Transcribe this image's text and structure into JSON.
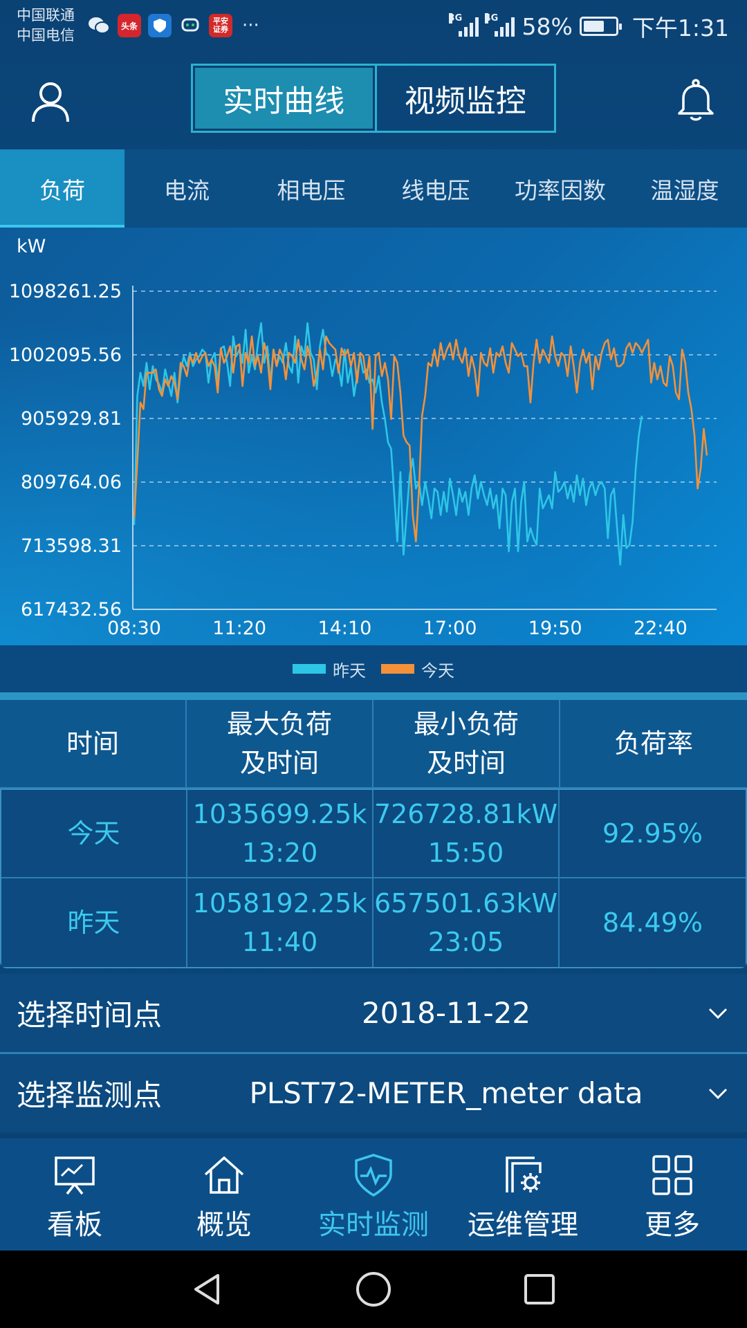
{
  "status_bar": {
    "carrier_1": "中国联通",
    "carrier_2": "中国电信",
    "notification_icons": [
      "wechat-icon",
      "toutiao-icon",
      "shield-app-icon",
      "cloud-chat-icon",
      "pingan-icon"
    ],
    "toutiao_label": "头条",
    "pingan_label": "平安\n证券",
    "more": "···",
    "signal_1_label": "3G",
    "signal_2_label": "4G",
    "battery_level": "58%",
    "battery_fraction": 0.58,
    "time": "下午1:31"
  },
  "header": {
    "user_icon": "user-icon",
    "bell_icon": "bell-icon",
    "segments": [
      {
        "label": "实时曲线",
        "active": true
      },
      {
        "label": "视频监控",
        "active": false
      }
    ]
  },
  "tabs": [
    {
      "label": "负荷",
      "active": true
    },
    {
      "label": "电流",
      "active": false
    },
    {
      "label": "相电压",
      "active": false
    },
    {
      "label": "线电压",
      "active": false
    },
    {
      "label": "功率因数",
      "active": false
    },
    {
      "label": "温湿度",
      "active": false
    }
  ],
  "chart_data": {
    "type": "line",
    "unit": "kW",
    "yticks": [
      "1098261.25",
      "1002095.56",
      "905929.81",
      "809764.06",
      "713598.31",
      "617432.56"
    ],
    "ylim": [
      617432.56,
      1098261.25
    ],
    "xticks": [
      "08:30",
      "11:20",
      "14:10",
      "17:00",
      "19:50",
      "22:40"
    ],
    "x_start_minutes": 510,
    "x_step_minutes": 5,
    "grid": "dashed-horizontal",
    "legend_placement": "bottom-center",
    "series": [
      {
        "name": "昨天",
        "color": "#2ec6e6",
        "values": [
          745000,
          940000,
          975000,
          955000,
          990000,
          950000,
          985000,
          965000,
          958000,
          945000,
          980000,
          960000,
          940000,
          975000,
          930000,
          975000,
          1000000,
          985000,
          1005000,
          985000,
          995000,
          1000000,
          1010000,
          1005000,
          960000,
          995000,
          1005000,
          960000,
          1012000,
          1015000,
          990000,
          955000,
          1030000,
          1000000,
          1010000,
          990000,
          1040000,
          975000,
          1000000,
          980000,
          1020000,
          1050000,
          990000,
          1015000,
          960000,
          1010000,
          985000,
          1000000,
          990000,
          1020000,
          985000,
          975000,
          1030000,
          960000,
          1015000,
          1000000,
          1050000,
          1005000,
          995000,
          950000,
          1015000,
          1040000,
          1005000,
          1000000,
          970000,
          995000,
          985000,
          955000,
          1010000,
          960000,
          985000,
          940000,
          970000,
          1000000,
          975000,
          980000,
          960000,
          965000,
          945000,
          970000,
          930000,
          905000,
          870000,
          860000,
          790000,
          720000,
          825000,
          700000,
          760000,
          820000,
          845000,
          800000,
          810000,
          775000,
          810000,
          785000,
          755000,
          800000,
          795000,
          760000,
          795000,
          765000,
          815000,
          790000,
          760000,
          800000,
          780000,
          795000,
          760000,
          800000,
          820000,
          785000,
          810000,
          790000,
          775000,
          800000,
          770000,
          790000,
          740000,
          800000,
          790000,
          705000,
          780000,
          800000,
          705000,
          780000,
          810000,
          720000,
          740000,
          725000,
          715000,
          800000,
          770000,
          780000,
          790000,
          770000,
          825000,
          795000,
          800000,
          810000,
          785000,
          805000,
          780000,
          820000,
          790000,
          815000,
          775000,
          800000,
          810000,
          790000,
          805000,
          810000,
          800000,
          725000,
          790000,
          800000,
          740000,
          685000,
          760000,
          710000,
          715000,
          750000,
          830000,
          880000,
          910000
        ]
      },
      {
        "name": "今天",
        "color": "#f4913a",
        "values": [
          756000,
          840000,
          930000,
          920000,
          975000,
          975000,
          975000,
          980000,
          950000,
          940000,
          965000,
          955000,
          970000,
          960000,
          935000,
          990000,
          985000,
          970000,
          1000000,
          990000,
          1005000,
          990000,
          1000000,
          1005000,
          985000,
          995000,
          985000,
          945000,
          1012000,
          990000,
          1000000,
          1015000,
          975000,
          1015000,
          1018000,
          955000,
          1005000,
          990000,
          1030000,
          985000,
          1000000,
          975000,
          1020000,
          1000000,
          950000,
          1010000,
          985000,
          1010000,
          1000000,
          965000,
          1005000,
          1000000,
          990000,
          1025000,
          995000,
          980000,
          1015000,
          995000,
          955000,
          975000,
          1010000,
          980000,
          1030000,
          1020000,
          1015000,
          1010000,
          975000,
          1012000,
          1000000,
          1010000,
          985000,
          1005000,
          960000,
          1005000,
          1000000,
          965000,
          1000000,
          890000,
          1000000,
          1005000,
          970000,
          990000,
          965000,
          905000,
          1000000,
          990000,
          945000,
          880000,
          870000,
          865000,
          760000,
          720000,
          800000,
          910000,
          940000,
          990000,
          985000,
          1010000,
          985000,
          1020000,
          995000,
          1010000,
          1020000,
          995000,
          1025000,
          1000000,
          990000,
          1012000,
          970000,
          1000000,
          980000,
          940000,
          1005000,
          990000,
          985000,
          1012000,
          975000,
          1005000,
          1000000,
          1015000,
          990000,
          975000,
          1020000,
          1010000,
          1000000,
          1005000,
          985000,
          985000,
          930000,
          990000,
          1025000,
          990000,
          1010000,
          1000000,
          990000,
          1030000,
          1000000,
          985000,
          1005000,
          1000000,
          970000,
          1015000,
          985000,
          945000,
          990000,
          1010000,
          990000,
          1005000,
          950000,
          1000000,
          980000,
          1005000,
          1020000,
          1025000,
          995000,
          1012000,
          985000,
          985000,
          990000,
          1012000,
          1020000,
          1005000,
          1020000,
          1015000,
          1005000,
          1015000,
          1025000,
          960000,
          990000,
          965000,
          985000,
          960000,
          955000,
          1000000,
          985000,
          945000,
          935000,
          1010000,
          990000,
          945000,
          920000,
          880000,
          800000,
          830000,
          890000,
          850000
        ]
      }
    ]
  },
  "legend": [
    {
      "label": "昨天",
      "color": "#2ec6e6"
    },
    {
      "label": "今天",
      "color": "#f4913a"
    }
  ],
  "table": {
    "headers": [
      "时间",
      "最大负荷\n及时间",
      "最小负荷\n及时间",
      "负荷率"
    ],
    "rows": [
      {
        "label": "今天",
        "max": "1035699.25k",
        "max_time": "13:20",
        "min": "726728.81kW",
        "min_time": "15:50",
        "rate": "92.95%"
      },
      {
        "label": "昨天",
        "max": "1058192.25k",
        "max_time": "11:40",
        "min": "657501.63kW",
        "min_time": "23:05",
        "rate": "84.49%"
      }
    ]
  },
  "selectors": {
    "time_label": "选择时间点",
    "time_value": "2018-11-22",
    "point_label": "选择监测点",
    "point_value": "PLST72-METER_meter data"
  },
  "bottom_nav": [
    {
      "label": "看板",
      "icon": "dashboard-icon",
      "active": false
    },
    {
      "label": "概览",
      "icon": "home-icon",
      "active": false
    },
    {
      "label": "实时监测",
      "icon": "shield-pulse-icon",
      "active": true
    },
    {
      "label": "运维管理",
      "icon": "maintenance-gear-icon",
      "active": false
    },
    {
      "label": "更多",
      "icon": "grid-icon",
      "active": false
    }
  ],
  "system_nav": [
    "back-icon",
    "home-circle-icon",
    "recents-icon"
  ]
}
